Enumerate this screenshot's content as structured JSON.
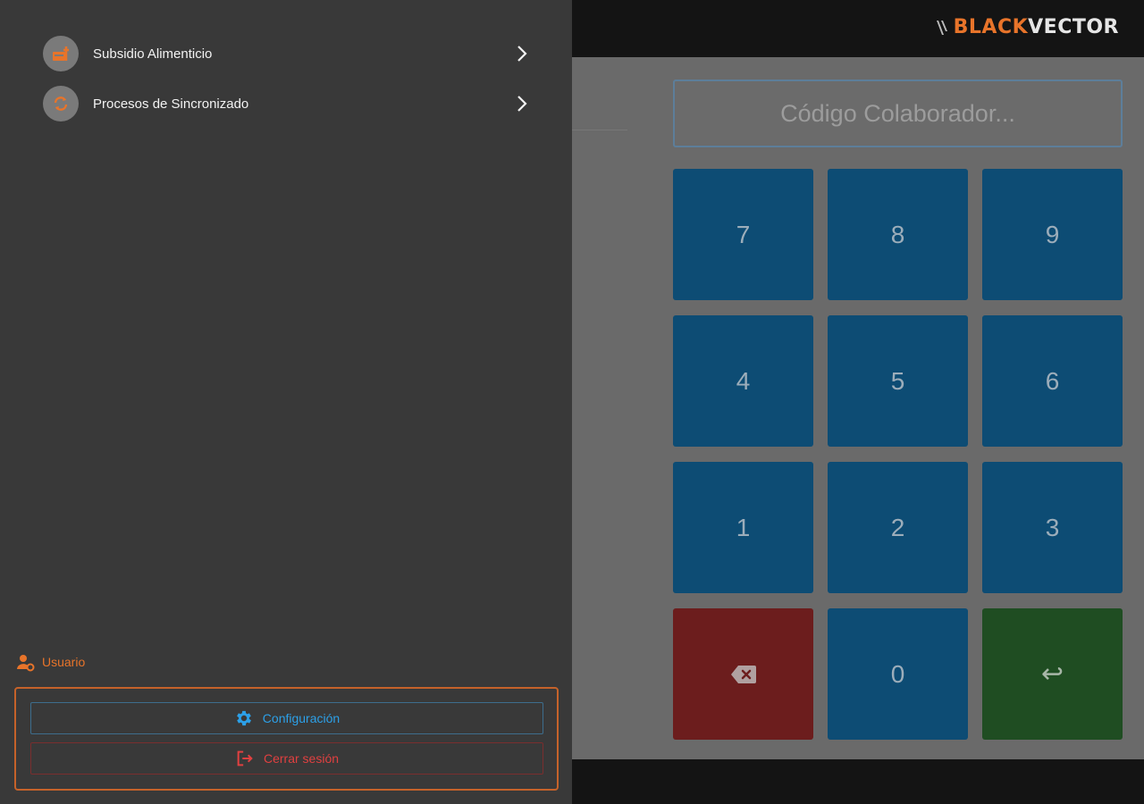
{
  "header": {
    "logo_black": "BLACK",
    "logo_vector": "VECTOR"
  },
  "input": {
    "placeholder": "Código Colaborador...",
    "value": ""
  },
  "keypad": {
    "keys": [
      "7",
      "8",
      "9",
      "4",
      "5",
      "6",
      "1",
      "2",
      "3",
      "backspace",
      "0",
      "enter"
    ],
    "k7": "7",
    "k8": "8",
    "k9": "9",
    "k4": "4",
    "k5": "5",
    "k6": "6",
    "k1": "1",
    "k2": "2",
    "k3": "3",
    "k0": "0",
    "enter_symbol": "↩"
  },
  "drawer": {
    "items": [
      {
        "label": "Subsidio Alimenticio",
        "icon": "food-subsidy-icon"
      },
      {
        "label": "Procesos de Sincronizado",
        "icon": "sync-icon"
      }
    ],
    "user_label": "Usuario",
    "config_label": "Configuración",
    "logout_label": "Cerrar sesión"
  },
  "colors": {
    "accent_orange": "#e8742a",
    "config_blue": "#2ca0e8",
    "logout_red": "#e04040",
    "key_blue": "#0d4c74",
    "key_red": "#6c1d1d",
    "key_green": "#1f4d22"
  }
}
